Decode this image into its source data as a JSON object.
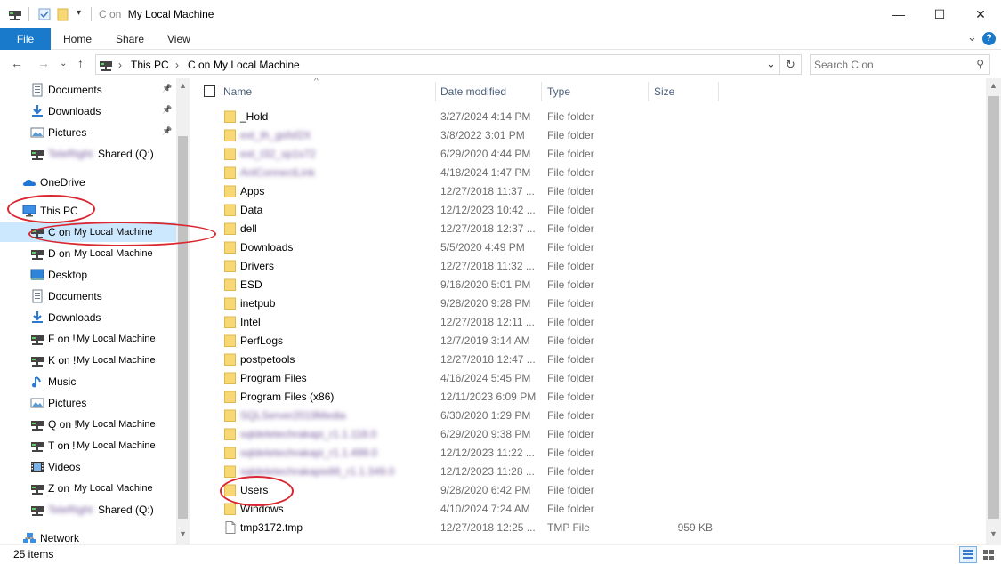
{
  "window": {
    "title_prefix": "C on",
    "title_name": "My Local Machine",
    "minimize": "—",
    "maximize": "☐",
    "close": "✕"
  },
  "ribbon": {
    "file": "File",
    "tabs": [
      "Home",
      "Share",
      "View"
    ],
    "expand": "⌄",
    "help": "?"
  },
  "address": {
    "crumbs": [
      "This PC",
      "C on",
      "My Local Machine"
    ],
    "dropdown": "⌄"
  },
  "search": {
    "placeholder": "Search C on"
  },
  "nav": [
    {
      "label": "Documents",
      "icon": "document-icon",
      "pinned": true
    },
    {
      "label": "Downloads",
      "icon": "download-icon",
      "pinned": true
    },
    {
      "label": "Pictures",
      "icon": "pictures-icon",
      "pinned": true
    },
    {
      "label": "Shared (Q:)",
      "icon": "network-drive-icon",
      "blurred_prefix": "TeleRight",
      "pinned": false
    },
    {
      "label": "OneDrive",
      "icon": "onedrive-icon"
    },
    {
      "label": "This PC",
      "icon": "computer-icon"
    },
    {
      "label": "C on",
      "suffix": "My Local Machine",
      "icon": "network-drive-icon",
      "selected": true
    },
    {
      "label": "D on",
      "suffix": "My Local Machine",
      "icon": "network-drive-icon"
    },
    {
      "label": "Desktop",
      "icon": "desktop-icon"
    },
    {
      "label": "Documents",
      "icon": "document-icon"
    },
    {
      "label": "Downloads",
      "icon": "download-icon"
    },
    {
      "label": "F on !",
      "suffix": "My Local Machine",
      "icon": "network-drive-icon"
    },
    {
      "label": "K on !",
      "suffix": "My Local Machine",
      "icon": "network-drive-icon"
    },
    {
      "label": "Music",
      "icon": "music-icon"
    },
    {
      "label": "Pictures",
      "icon": "pictures-icon"
    },
    {
      "label": "Q on !",
      "suffix": "My Local Machine",
      "icon": "network-drive-icon"
    },
    {
      "label": "T on !",
      "suffix": "My Local Machine",
      "icon": "network-drive-icon"
    },
    {
      "label": "Videos",
      "icon": "videos-icon"
    },
    {
      "label": "Z on",
      "suffix": "My Local Machine",
      "icon": "network-drive-icon"
    },
    {
      "label": "Shared (Q:)",
      "icon": "network-drive-icon",
      "blurred_prefix": "TeleRight"
    },
    {
      "label": "Network",
      "icon": "network-icon"
    }
  ],
  "columns": {
    "name": "Name",
    "date": "Date modified",
    "type": "Type",
    "size": "Size",
    "sort_indicator": "^"
  },
  "files": [
    {
      "name": "_Hold",
      "date": "3/27/2024 4:14 PM",
      "type": "File folder",
      "size": ""
    },
    {
      "name": "ext_th_gsfsf2X",
      "date": "3/8/2022 3:01 PM",
      "type": "File folder",
      "size": "",
      "blurred": true
    },
    {
      "name": "ext_t32_sp1s72",
      "date": "6/29/2020 4:44 PM",
      "type": "File folder",
      "size": "",
      "blurred": true
    },
    {
      "name": "AnlConnectLink",
      "date": "4/18/2024 1:47 PM",
      "type": "File folder",
      "size": "",
      "blurred": true
    },
    {
      "name": "Apps",
      "date": "12/27/2018 11:37 ...",
      "type": "File folder",
      "size": ""
    },
    {
      "name": "Data",
      "date": "12/12/2023 10:42 ...",
      "type": "File folder",
      "size": ""
    },
    {
      "name": "dell",
      "date": "12/27/2018 12:37 ...",
      "type": "File folder",
      "size": ""
    },
    {
      "name": "Downloads",
      "date": "5/5/2020 4:49 PM",
      "type": "File folder",
      "size": ""
    },
    {
      "name": "Drivers",
      "date": "12/27/2018 11:32 ...",
      "type": "File folder",
      "size": ""
    },
    {
      "name": "ESD",
      "date": "9/16/2020 5:01 PM",
      "type": "File folder",
      "size": ""
    },
    {
      "name": "inetpub",
      "date": "9/28/2020 9:28 PM",
      "type": "File folder",
      "size": ""
    },
    {
      "name": "Intel",
      "date": "12/27/2018 12:11 ...",
      "type": "File folder",
      "size": ""
    },
    {
      "name": "PerfLogs",
      "date": "12/7/2019 3:14 AM",
      "type": "File folder",
      "size": ""
    },
    {
      "name": "postpetools",
      "date": "12/27/2018 12:47 ...",
      "type": "File folder",
      "size": ""
    },
    {
      "name": "Program Files",
      "date": "4/16/2024 5:45 PM",
      "type": "File folder",
      "size": ""
    },
    {
      "name": "Program Files (x86)",
      "date": "12/11/2023 6:09 PM",
      "type": "File folder",
      "size": ""
    },
    {
      "name": "SQLServer2019Media",
      "date": "6/30/2020 1:29 PM",
      "type": "File folder",
      "size": "",
      "blurred": true
    },
    {
      "name": "sqldeletechrakapi_r1.1.118.0",
      "date": "6/29/2020 9:38 PM",
      "type": "File folder",
      "size": "",
      "blurred": true
    },
    {
      "name": "sqldeletechrakapi_r1.1.499.0",
      "date": "12/12/2023 11:22 ...",
      "type": "File folder",
      "size": "",
      "blurred": true
    },
    {
      "name": "sqldeletechrakapix86_r1.1.349.0",
      "date": "12/12/2023 11:28 ...",
      "type": "File folder",
      "size": "",
      "blurred": true
    },
    {
      "name": "Users",
      "date": "9/28/2020 6:42 PM",
      "type": "File folder",
      "size": ""
    },
    {
      "name": "Windows",
      "date": "4/10/2024 7:24 AM",
      "type": "File folder",
      "size": ""
    },
    {
      "name": "tmp3172.tmp",
      "date": "12/27/2018 12:25 ...",
      "type": "TMP File",
      "size": "959 KB",
      "file": true
    }
  ],
  "status": {
    "count": "25 items"
  },
  "colors": {
    "accent": "#1979ca",
    "annotation": "#d9262f",
    "folder": "#f8d775"
  }
}
